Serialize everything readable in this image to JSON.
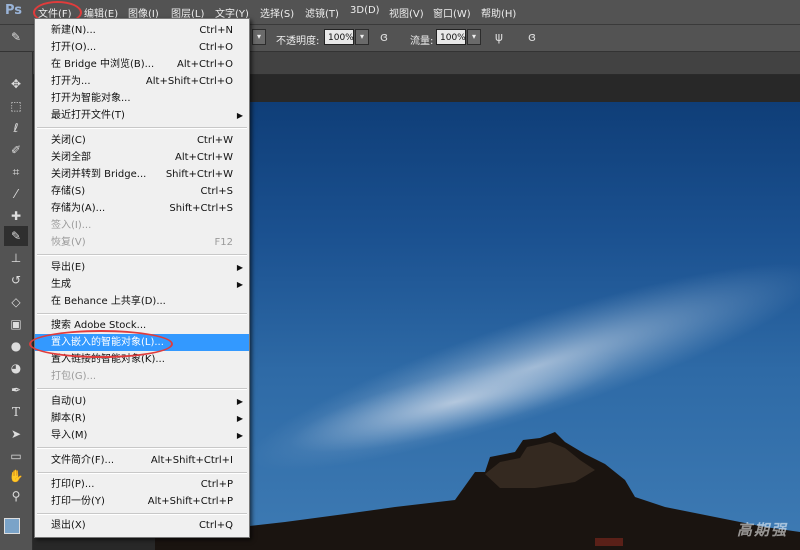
{
  "app": {
    "logo": "Ps"
  },
  "menubar": {
    "items": [
      "文件(F)",
      "编辑(E)",
      "图像(I)",
      "图层(L)",
      "文字(Y)",
      "选择(S)",
      "滤镜(T)",
      "3D(D)",
      "视图(V)",
      "窗口(W)",
      "帮助(H)"
    ]
  },
  "options_bar": {
    "opacity_label": "不透明度:",
    "opacity_value": "100%",
    "flow_label": "流量:",
    "flow_value": "100%"
  },
  "file_menu": {
    "items": [
      {
        "label": "新建(N)...",
        "shortcut": "Ctrl+N"
      },
      {
        "label": "打开(O)...",
        "shortcut": "Ctrl+O"
      },
      {
        "label": "在 Bridge 中浏览(B)...",
        "shortcut": "Alt+Ctrl+O"
      },
      {
        "label": "打开为...",
        "shortcut": "Alt+Shift+Ctrl+O"
      },
      {
        "label": "打开为智能对象...",
        "shortcut": ""
      },
      {
        "label": "最近打开文件(T)",
        "shortcut": ""
      },
      {
        "label": "关闭(C)",
        "shortcut": "Ctrl+W"
      },
      {
        "label": "关闭全部",
        "shortcut": "Alt+Ctrl+W"
      },
      {
        "label": "关闭并转到 Bridge...",
        "shortcut": "Shift+Ctrl+W"
      },
      {
        "label": "存储(S)",
        "shortcut": "Ctrl+S"
      },
      {
        "label": "存储为(A)...",
        "shortcut": "Shift+Ctrl+S"
      },
      {
        "label": "签入(I)...",
        "shortcut": ""
      },
      {
        "label": "恢复(V)",
        "shortcut": "F12"
      },
      {
        "label": "导出(E)",
        "shortcut": ""
      },
      {
        "label": "生成",
        "shortcut": ""
      },
      {
        "label": "在 Behance 上共享(D)...",
        "shortcut": ""
      },
      {
        "label": "搜索 Adobe Stock...",
        "shortcut": ""
      },
      {
        "label": "置入嵌入的智能对象(L)...",
        "shortcut": ""
      },
      {
        "label": "置入链接的智能对象(K)...",
        "shortcut": ""
      },
      {
        "label": "打包(G)...",
        "shortcut": ""
      },
      {
        "label": "自动(U)",
        "shortcut": ""
      },
      {
        "label": "脚本(R)",
        "shortcut": ""
      },
      {
        "label": "导入(M)",
        "shortcut": ""
      },
      {
        "label": "文件简介(F)...",
        "shortcut": "Alt+Shift+Ctrl+I"
      },
      {
        "label": "打印(P)...",
        "shortcut": "Ctrl+P"
      },
      {
        "label": "打印一份(Y)",
        "shortcut": "Alt+Shift+Ctrl+P"
      },
      {
        "label": "退出(X)",
        "shortcut": "Ctrl+Q"
      }
    ]
  },
  "canvas": {
    "watermark": "高期强"
  }
}
